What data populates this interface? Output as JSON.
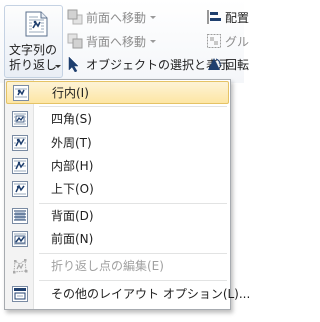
{
  "ribbon": {
    "wrap_text_button": {
      "line1": "文字列の",
      "line2": "折り返し",
      "icon": "text-wrap-icon"
    },
    "bring_forward": "前面へ移動",
    "send_backward": "背面へ移動",
    "selection_pane": "オブジェクトの選択と表示",
    "align": "配置",
    "group": "グル",
    "rotate": "回転"
  },
  "menu": {
    "items": [
      {
        "label": "行内(I)",
        "icon": "wrap-inline-icon",
        "selected": true,
        "enabled": true
      },
      {
        "label": "四角(S)",
        "icon": "wrap-square-icon",
        "selected": false,
        "enabled": true
      },
      {
        "label": "外周(T)",
        "icon": "wrap-tight-icon",
        "selected": false,
        "enabled": true
      },
      {
        "label": "内部(H)",
        "icon": "wrap-through-icon",
        "selected": false,
        "enabled": true
      },
      {
        "label": "上下(O)",
        "icon": "wrap-top-bottom-icon",
        "selected": false,
        "enabled": true
      },
      {
        "label": "背面(D)",
        "icon": "behind-text-icon",
        "selected": false,
        "enabled": true
      },
      {
        "label": "前面(N)",
        "icon": "in-front-of-text-icon",
        "selected": false,
        "enabled": true
      },
      {
        "label": "折り返し点の編集(E)",
        "icon": "edit-wrap-points-icon",
        "selected": false,
        "enabled": false
      },
      {
        "label": "その他のレイアウト オプション(L)...",
        "icon": "more-layout-options-icon",
        "selected": false,
        "enabled": true
      }
    ]
  },
  "colors": {
    "highlight": "#fde6a4",
    "icon_blue": "#1f3f6e",
    "disabled_text": "#a0a0a0"
  }
}
